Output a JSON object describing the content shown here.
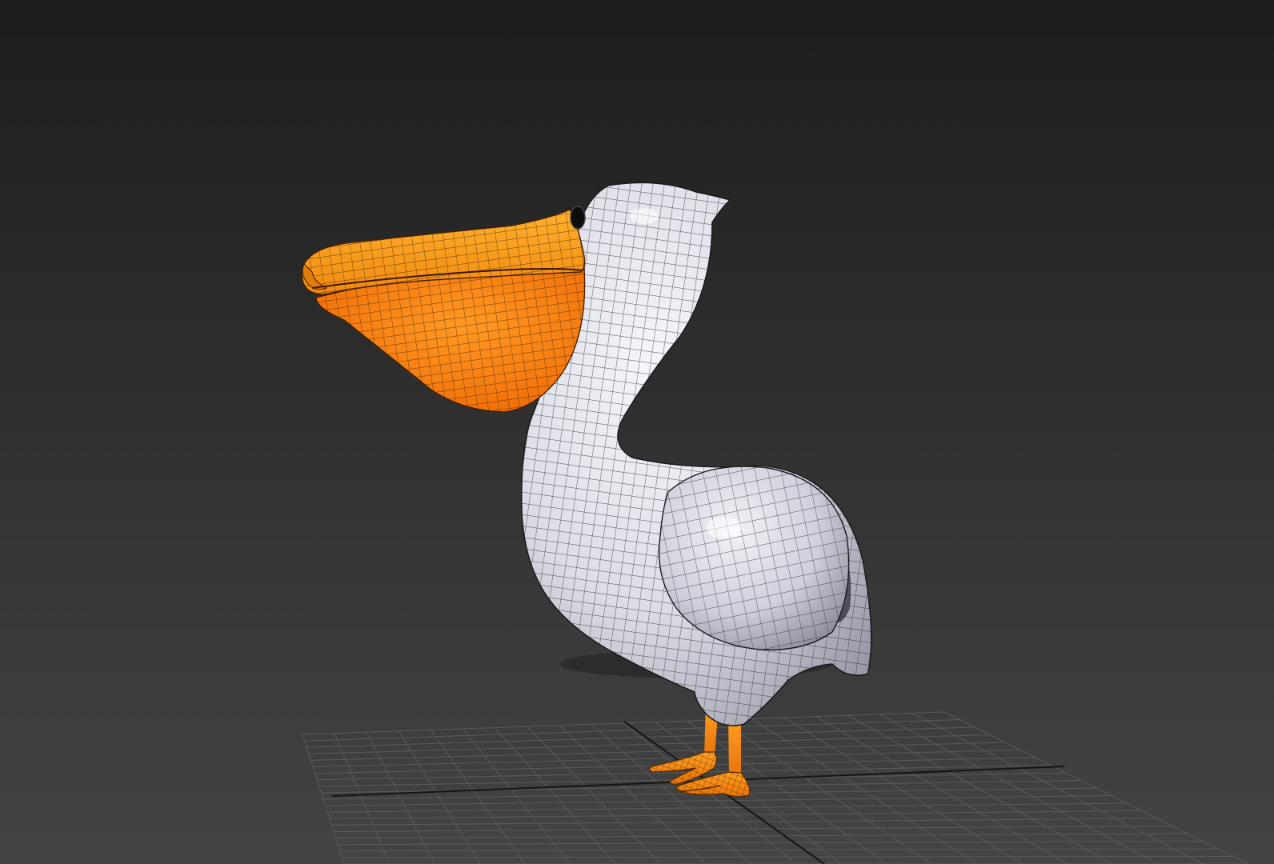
{
  "viewport": {
    "background_top": "#1d1d1d",
    "background_bottom": "#444444",
    "grid_color": "#5a5a5a",
    "grid_axis_color": "#151515",
    "shading": "smooth-with-wireframe-edges"
  },
  "model": {
    "subject": "cartoon pelican",
    "body_color": "#e4e4ee",
    "body_shade_color": "#8a8a98",
    "beak_color": "#ff9a1c",
    "pouch_color": "#ff7a10",
    "feet_color": "#ff8a18",
    "wire_color": "#1c1c22",
    "eye_color": "#0d0d0d"
  }
}
